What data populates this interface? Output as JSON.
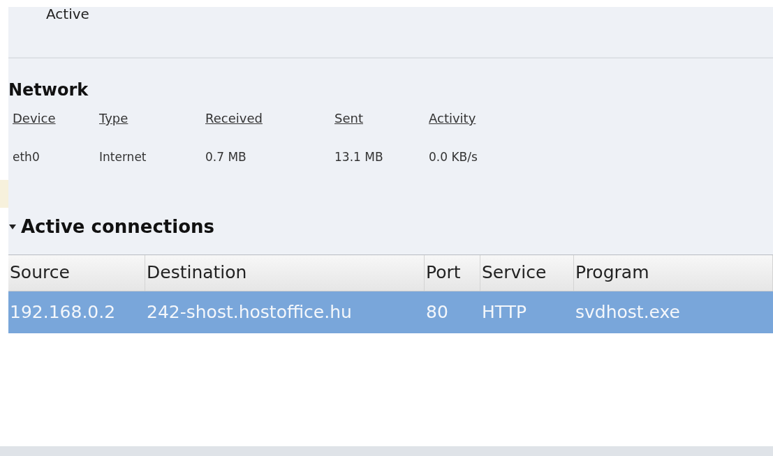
{
  "status": {
    "label": "Active"
  },
  "network": {
    "title": "Network",
    "columns": [
      "Device",
      "Type",
      "Received",
      "Sent",
      "Activity"
    ],
    "rows": [
      [
        "eth0",
        "Internet",
        "0.7 MB",
        "13.1 MB",
        "0.0 KB/s"
      ]
    ]
  },
  "connections": {
    "title": "Active connections",
    "expanded": true,
    "columns": [
      "Source",
      "Destination",
      "Port",
      "Service",
      "Program"
    ],
    "rows": [
      {
        "cells": [
          "192.168.0.2",
          "242-shost.hostoffice.hu",
          "80",
          "HTTP",
          "svdhost.exe"
        ],
        "selected": true
      }
    ]
  }
}
